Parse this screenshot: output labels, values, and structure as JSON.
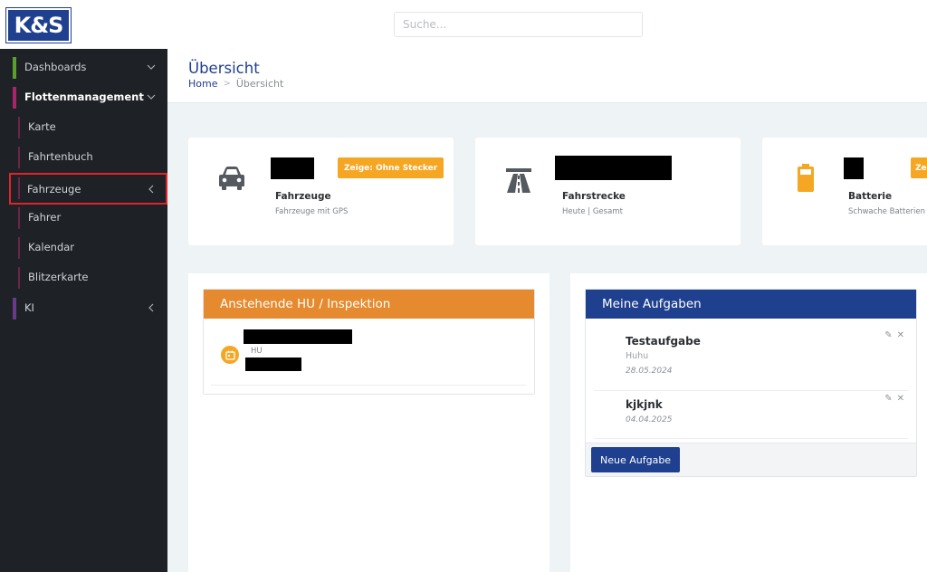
{
  "brand": {
    "logo_text": "K&S",
    "color": "#1f3f8f"
  },
  "search": {
    "placeholder": "Suche..."
  },
  "sidebar": {
    "items": [
      {
        "label": "Dashboards",
        "accent": "#5aa02c",
        "chevron": "down"
      },
      {
        "label": "Flottenmanagement",
        "accent": "#a8246b",
        "chevron": "down"
      },
      {
        "label": "Karte"
      },
      {
        "label": "Fahrtenbuch"
      },
      {
        "label": "Fahrzeuge",
        "chevron": "left",
        "selected": true
      },
      {
        "label": "Fahrer"
      },
      {
        "label": "Kalendar"
      },
      {
        "label": "Blitzerkarte"
      },
      {
        "label": "KI",
        "accent": "#6a3a8a",
        "chevron": "left"
      }
    ]
  },
  "header": {
    "title": "Übersicht",
    "breadcrumb": [
      "Home",
      "Übersicht"
    ]
  },
  "stats": [
    {
      "icon": "car-icon",
      "button": "Zeige: Ohne Stecker",
      "title": "Fahrzeuge",
      "subtitle": "Fahrzeuge mit GPS"
    },
    {
      "icon": "highway-icon",
      "title": "Fahrstrecke",
      "subtitle": "Heute | Gesamt"
    },
    {
      "icon": "battery-icon",
      "button": "Zeige",
      "title": "Batterie",
      "subtitle": "Schwache Batterien"
    }
  ],
  "hu_widget": {
    "title": "Anstehende HU / Inspektion",
    "color": "#e58a2e",
    "rows": [
      {
        "label": "HU"
      }
    ]
  },
  "tasks_widget": {
    "title": "Meine Aufgaben",
    "color": "#1f3f8f",
    "tasks": [
      {
        "title": "Testaufgabe",
        "description": "Huhu",
        "date": "28.05.2024"
      },
      {
        "title": "kjkjnk",
        "date": "04.04.2025"
      }
    ],
    "new_button": "Neue Aufgabe"
  }
}
